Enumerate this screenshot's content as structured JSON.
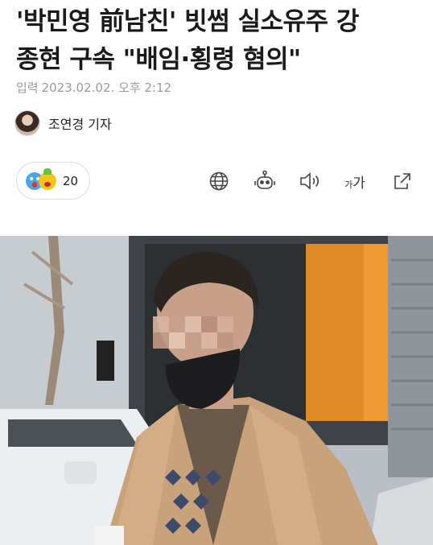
{
  "article": {
    "headline_line1": "'박민영 前남친' 빗썸 실소유주 강",
    "headline_line2": "종현 구속 \"배임·횡령 혐의\"",
    "date_label": "입력",
    "date_value": "2023.02.02. 오후 2:12",
    "reporter": "조연경 기자"
  },
  "reactions": {
    "count": "20",
    "emojis": [
      "surprised-emoji",
      "angry-emoji"
    ]
  },
  "toolbar": {
    "icons": [
      "globe-icon",
      "robot-summary-icon",
      "speaker-icon",
      "font-size-icon",
      "share-icon"
    ],
    "font_size_small": "가",
    "font_size_large": "가"
  },
  "photo": {
    "description_icon": "news-photo"
  },
  "colors": {
    "meta_text": "#9a9a9a",
    "headline_text": "#1a1a1a"
  }
}
